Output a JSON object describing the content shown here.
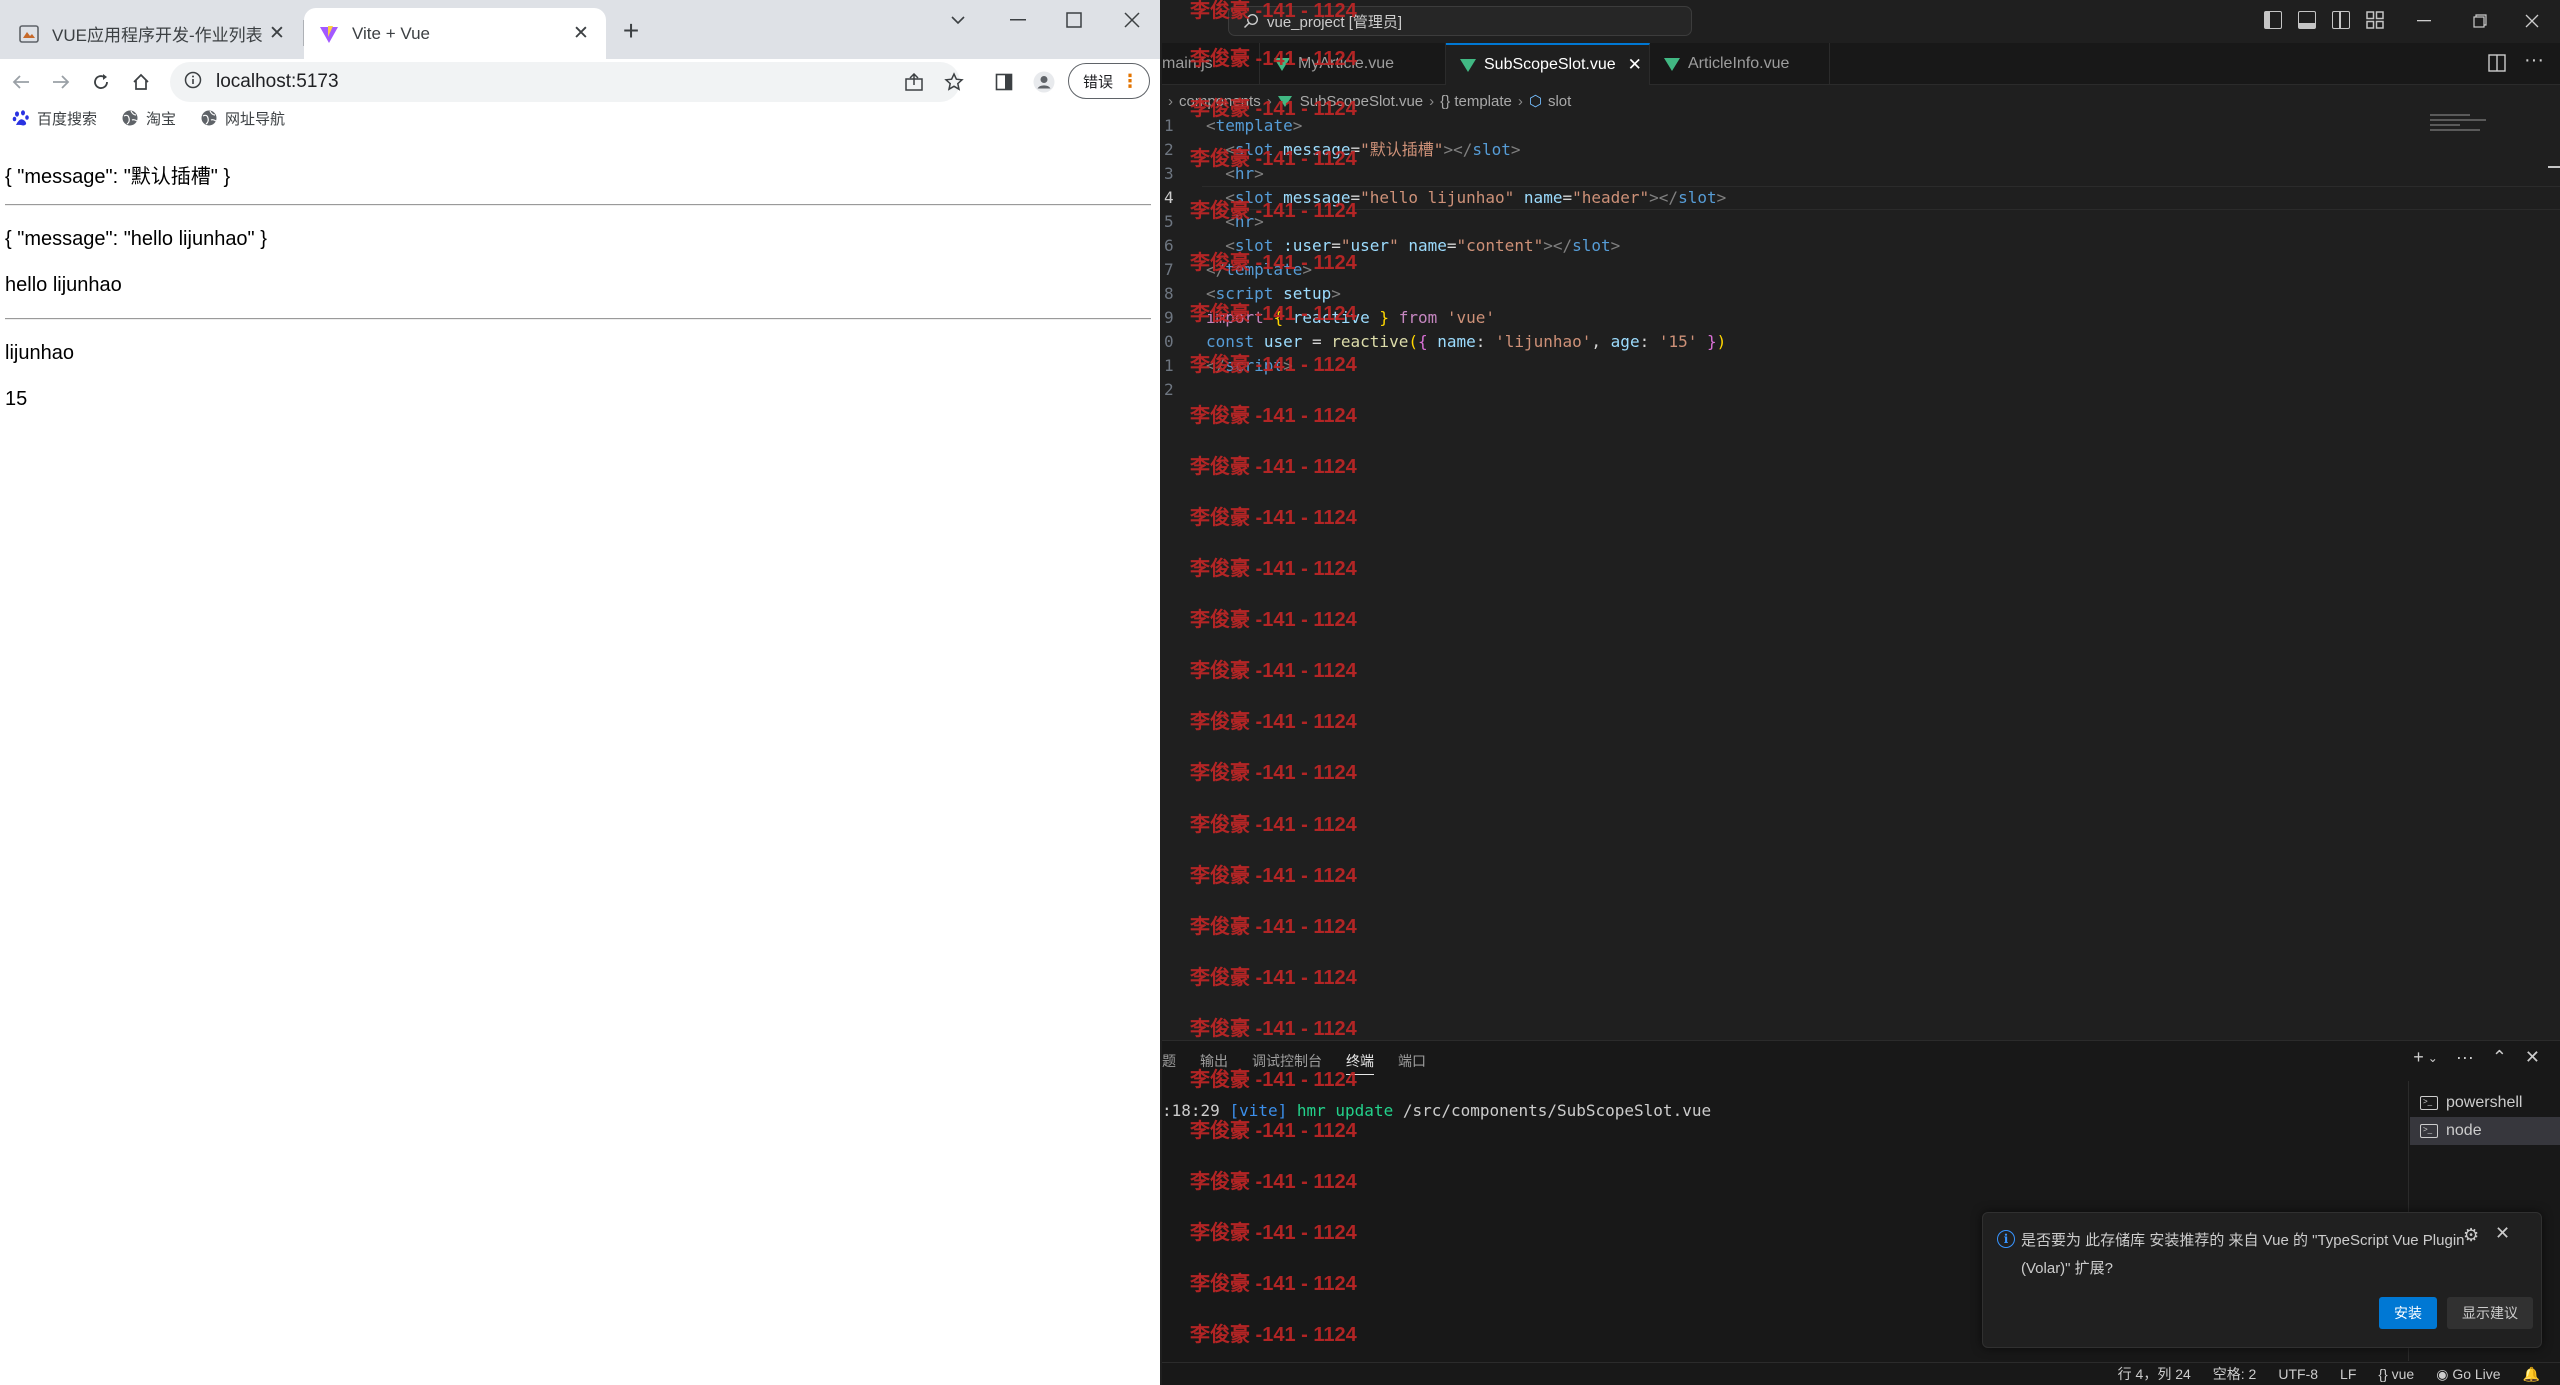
{
  "browser": {
    "tabs": [
      {
        "title": "VUE应用程序开发-作业列表",
        "active": false
      },
      {
        "title": "Vite + Vue",
        "active": true
      }
    ],
    "url": "localhost:5173",
    "error_chip": "错误",
    "bookmarks": [
      {
        "label": "百度搜索",
        "icon": "baidu-paw-icon"
      },
      {
        "label": "淘宝",
        "icon": "globe-icon"
      },
      {
        "label": "网址导航",
        "icon": "globe-icon"
      }
    ],
    "page": {
      "line1": "{ \"message\": \"默认插槽\" }",
      "line2": "{ \"message\": \"hello lijunhao\" }",
      "line3": "hello lijunhao",
      "line4": "lijunhao",
      "line5": "15"
    }
  },
  "vscode": {
    "title": "vue_project [管理员]",
    "tabs": [
      {
        "label": "main.js",
        "active": false
      },
      {
        "label": "MyArticle.vue",
        "active": false
      },
      {
        "label": "SubScopeSlot.vue",
        "active": true
      },
      {
        "label": "ArticleInfo.vue",
        "active": false
      }
    ],
    "breadcrumb": [
      "components",
      "SubScopeSlot.vue",
      "{} template",
      "slot"
    ],
    "editor": {
      "line_numbers": [
        "1",
        "2",
        "3",
        "4",
        "5",
        "6",
        "7",
        "8",
        "9",
        "0",
        "1",
        "2"
      ],
      "current_line": "4"
    },
    "watermark_text": "李俊豪 -141 - 1124",
    "panel": {
      "tabs": [
        "题",
        "输出",
        "调试控制台",
        "终端",
        "端口"
      ],
      "active_tab": "终端",
      "terminal_time": ":18:29",
      "terminal_vite": "[vite]",
      "terminal_update": "hmr update",
      "terminal_path": "/src/components/SubScopeSlot.vue",
      "terminals": [
        "powershell",
        "node"
      ]
    },
    "notification": {
      "message": "是否要为 此存储库 安装推荐的 来自 Vue 的 \"TypeScript Vue Plugin (Volar)\" 扩展?",
      "install_label": "安装",
      "show_recommendations_label": "显示建议"
    },
    "status": {
      "position": "行 4，列 24",
      "spaces": "空格: 2",
      "encoding": "UTF-8",
      "eol": "LF",
      "language": "vue",
      "golive": "Go Live"
    }
  }
}
